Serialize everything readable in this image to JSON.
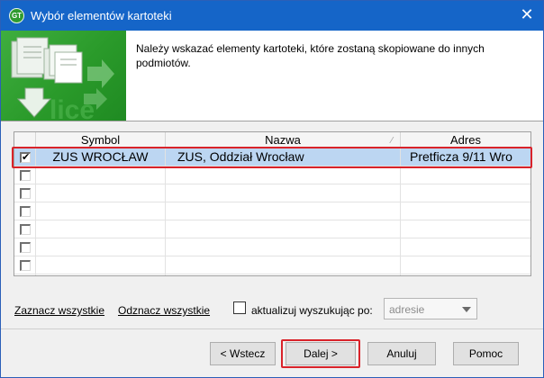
{
  "window": {
    "title": "Wybór elementów kartoteki",
    "close_glyph": "✕",
    "app_icon_text": "GT",
    "accent": "#1565c8"
  },
  "banner": {
    "message": "Należy wskazać elementy kartoteki, które zostaną skopiowane do innych podmiotów.",
    "art_icon": "copy-documents-arrow-icon",
    "art_color": "#2a9a2a"
  },
  "grid": {
    "columns": [
      "Symbol",
      "Nazwa",
      "Adres"
    ],
    "rows": [
      {
        "checked": true,
        "symbol": "ZUS WROCŁAW",
        "nazwa": "ZUS, Oddział Wrocław",
        "adres": "Pretficza 9/11 Wro"
      }
    ],
    "empty_rows": 7,
    "check_glyph": "✔",
    "highlight_color": "#d9232a"
  },
  "actions": {
    "select_all": "Zaznacz wszystkie",
    "deselect_all": "Odznacz wszystkie",
    "update_label": "aktualizuj wyszukując po:",
    "update_checked": false,
    "search_by_value": "adresie"
  },
  "buttons": {
    "back": "< Wstecz",
    "next": "Dalej >",
    "cancel": "Anuluj",
    "help": "Pomoc"
  }
}
